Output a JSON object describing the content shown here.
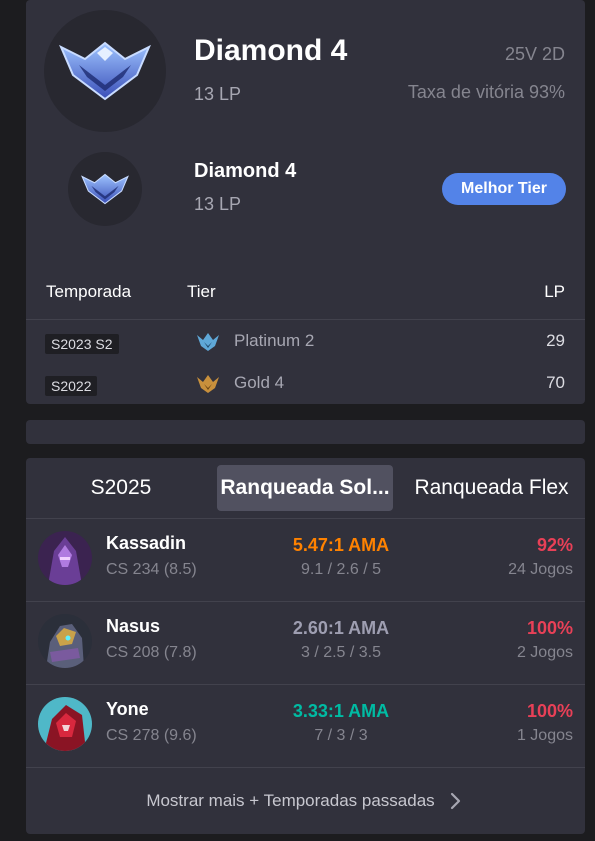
{
  "current_rank": {
    "tier": "Diamond 4",
    "lp": "13 LP",
    "win_loss": "25V 2D",
    "win_rate": "Taxa de vitória 93%"
  },
  "best_rank": {
    "tier": "Diamond 4",
    "lp": "13 LP",
    "badge": "Melhor Tier"
  },
  "season_table": {
    "headers": {
      "season": "Temporada",
      "tier": "Tier",
      "lp": "LP"
    },
    "rows": [
      {
        "season": "S2023 S2",
        "tier": "Platinum 2",
        "lp": "29",
        "icon": "platinum-emblem-icon",
        "color": "#5fa8d8"
      },
      {
        "season": "S2022",
        "tier": "Gold 4",
        "lp": "70",
        "icon": "gold-emblem-icon",
        "color": "#c8903c"
      }
    ]
  },
  "tabs": {
    "season": "S2025",
    "solo": "Ranqueada Sol...",
    "flex": "Ranqueada Flex"
  },
  "champions": [
    {
      "name": "Kassadin",
      "cs": "CS 234 (8.5)",
      "kda": "5.47:1 AMA",
      "kda_detail": "9.1 / 2.6 / 5",
      "winrate": "92%",
      "games": "24 Jogos",
      "kda_color": "#ff8200"
    },
    {
      "name": "Nasus",
      "cs": "CS 208 (7.8)",
      "kda": "2.60:1 AMA",
      "kda_detail": "3 / 2.5 / 3.5",
      "winrate": "100%",
      "games": "2 Jogos",
      "kda_color": "#9e9eb1"
    },
    {
      "name": "Yone",
      "cs": "CS 278 (9.6)",
      "kda": "3.33:1 AMA",
      "kda_detail": "7 / 3 / 3",
      "winrate": "100%",
      "games": "1 Jogos",
      "kda_color": "#00bba3"
    }
  ],
  "show_more": "Mostrar mais + Temporadas passadas",
  "colors": {
    "accent": "#5383e8",
    "loss_red": "#e84057",
    "card": "#31313c",
    "background": "#1c1c1f"
  }
}
